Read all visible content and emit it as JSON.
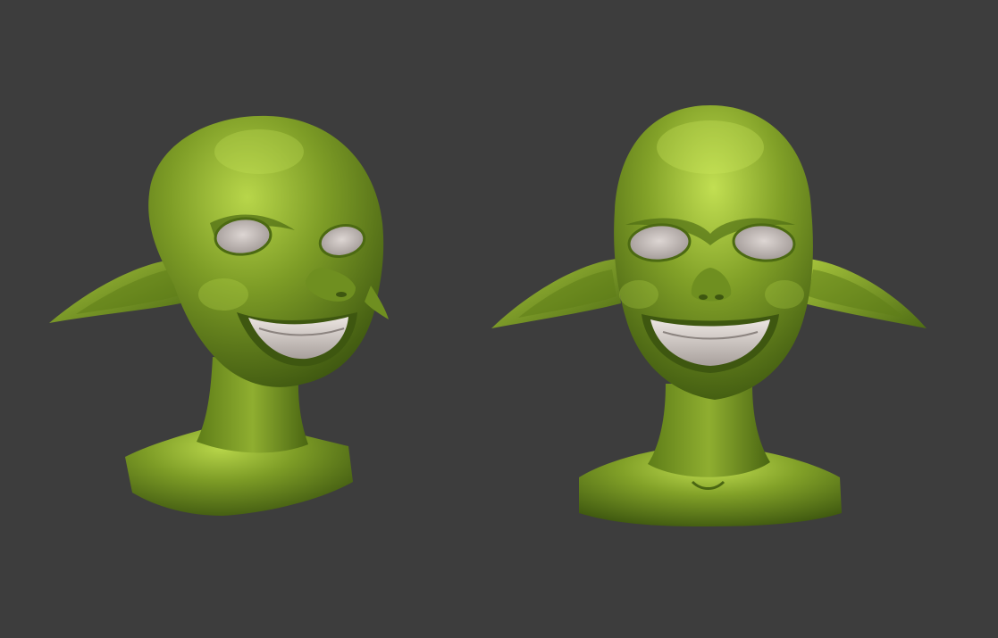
{
  "scene": {
    "background_color": "#3d3d3d",
    "skin_color": "#7d9c26",
    "skin_highlight": "#b8d64a",
    "skin_shadow": "#3e5710",
    "teeth_color": "#d8d0cc",
    "eye_color": "#c9c1be"
  },
  "models": [
    {
      "id": "goblin-bust-three-quarter",
      "view": "three-quarter"
    },
    {
      "id": "goblin-bust-front",
      "view": "front"
    }
  ]
}
